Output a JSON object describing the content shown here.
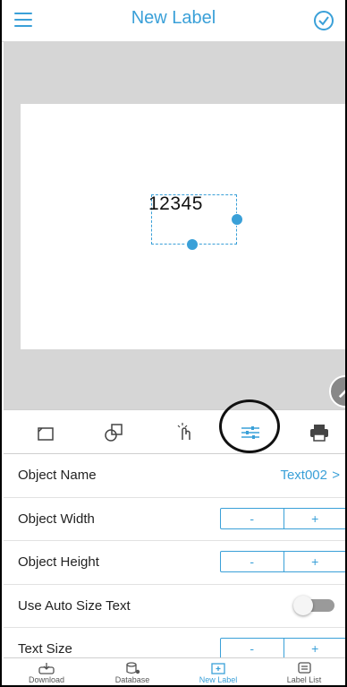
{
  "header": {
    "title": "New Label"
  },
  "label": {
    "text_object_value": "12345"
  },
  "props": {
    "object_name": {
      "label": "Object Name",
      "value": "Text002",
      "chevron": ">"
    },
    "object_width": {
      "label": "Object Width",
      "minus": "-",
      "plus": "+"
    },
    "object_height": {
      "label": "Object Height",
      "minus": "-",
      "plus": "+"
    },
    "auto_size": {
      "label": "Use Auto Size Text"
    },
    "text_size": {
      "label": "Text Size",
      "minus": "-",
      "plus": "+"
    }
  },
  "bottom_nav": {
    "download": "Download",
    "database": "Database",
    "new_label": "New Label",
    "label_list": "Label List"
  },
  "colors": {
    "accent": "#3aa0d8",
    "canvas_bg": "#d6d6d6"
  },
  "icons": [
    "menu-icon",
    "check-circle-icon",
    "label-shape-icon",
    "shapes-icon",
    "touch-icon",
    "sliders-icon",
    "printer-icon",
    "pencil-icon"
  ]
}
